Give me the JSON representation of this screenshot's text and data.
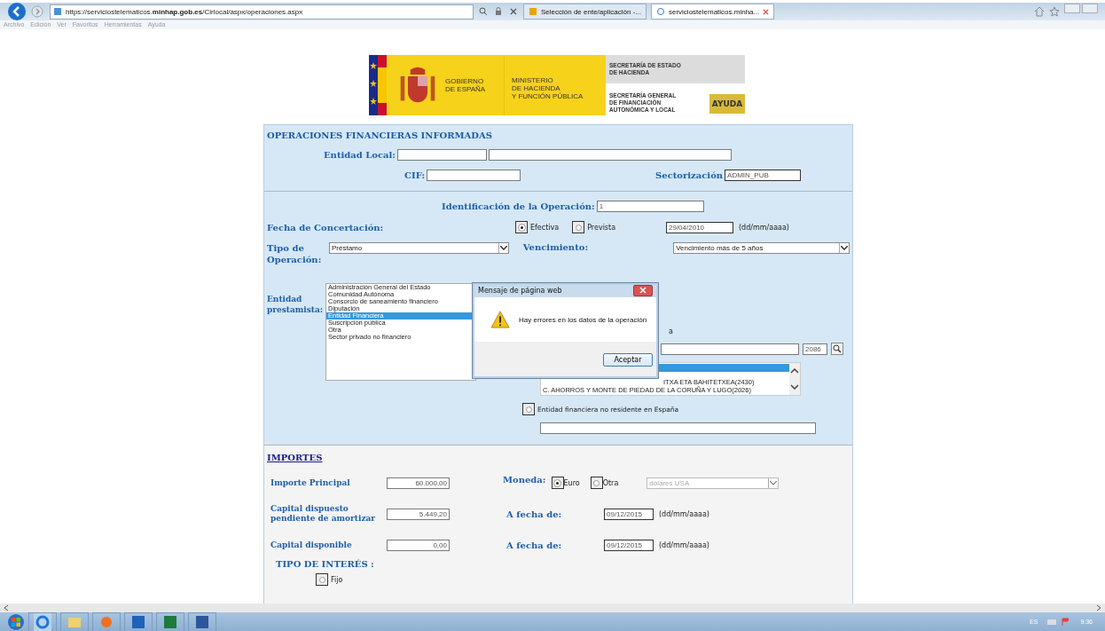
{
  "browser": {
    "address": "https://serviciostelematicos.**minhap.gob.es**/Cirlocal/aspx/operaciones.aspx",
    "tabs": [
      {
        "label": "Selección de ente/aplicación -...",
        "selected": false
      },
      {
        "label": "serviciostelematicos.minha...",
        "selected": true
      }
    ],
    "menu": [
      "Archivo",
      "Edición",
      "Ver",
      "Favoritos",
      "Herramientas",
      "Ayuda"
    ]
  },
  "banner": {
    "gobierno": [
      "GOBIERNO",
      "DE ESPAÑA"
    ],
    "ministerio": [
      "MINISTERIO",
      "DE HACIENDA",
      "Y FUNCIÓN PÚBLICA"
    ],
    "secretaria_estado": [
      "SECRETARÍA DE ESTADO",
      "DE HACIENDA"
    ],
    "secretaria_general": [
      "SECRETARÍA GENERAL",
      "DE FINANCIACIÓN",
      "AUTONÓMICA Y LOCAL"
    ],
    "help_button": "AYUDA"
  },
  "form": {
    "title": "OPERACIONES FINANCIERAS INFORMADAS",
    "entidad_local_label": "Entidad Local:",
    "cif_label": "CIF:",
    "sectorizacion_label": "Sectorización",
    "sectorizacion_value": "ADMIN_PUB",
    "identificacion_label": "Identificación de la Operación:",
    "identificacion_value": "1",
    "fecha_label": "Fecha de Concertación:",
    "fecha_options": [
      {
        "label": "Efectiva",
        "selected": true
      },
      {
        "label": "Prevista",
        "selected": false
      }
    ],
    "fecha_value": "29/04/2010",
    "fecha_hint": "(dd/mm/aaaa)",
    "tipo_label": "Tipo de Operación:",
    "tipo_value": "Préstamo",
    "vencimiento_label": "Vencimiento:",
    "vencimiento_value": "Vencimiento más de 5 años",
    "prestamista_label": "Entidad prestamista:",
    "prestamista_options": [
      {
        "label": "Administración General del Estado",
        "selected": false
      },
      {
        "label": "Comunidad Autónoma",
        "selected": false
      },
      {
        "label": "Consorcio de saneamiento financiero",
        "selected": false
      },
      {
        "label": "Diputación",
        "selected": false
      },
      {
        "label": "Entidad Financiera",
        "selected": true
      },
      {
        "label": "Suscripción pública",
        "selected": false
      },
      {
        "label": "Otra",
        "selected": false
      },
      {
        "label": "Sector privado no financiero",
        "selected": false
      }
    ],
    "entidad_label_fragment": "a",
    "entidad_code": "2086",
    "entidades": [
      {
        "selected": true
      },
      {
        "text": "ITXA ETA BAHITETXEA(2430)",
        "selected": false
      },
      {
        "text": "C. AHORROS Y MONTE DE PIEDAD DE LA CORUÑA Y LUGO(2026)",
        "selected": false
      }
    ],
    "no_residente": {
      "label": "Entidad financiera no residente en España",
      "selected": false
    }
  },
  "importes": {
    "title": "IMPORTES",
    "principal_label": "Importe Principal",
    "principal_value": "60.000,00",
    "moneda_label": "Moneda:",
    "moneda_options": [
      {
        "label": "Euro",
        "selected": true
      },
      {
        "label": "Otra",
        "selected": false
      }
    ],
    "moneda_value": "dólares USA",
    "dispuesto_label": "Capital dispuesto pendiente de amortizar",
    "dispuesto_value": "5.449,20",
    "dispuesto_fecha_label": "A fecha de:",
    "dispuesto_fecha": "09/12/2015",
    "dispuesto_hint": "(dd/mm/aaaa)",
    "disponible_label": "Capital disponible",
    "disponible_value": "0,00",
    "disponible_fecha_label": "A fecha de:",
    "disponible_fecha": "09/12/2015",
    "disponible_hint": "(dd/mm/aaaa)",
    "interes_title": "TIPO DE INTERÉS :",
    "interes_options": [
      {
        "label": "Fijo",
        "selected": false
      }
    ]
  },
  "dialog": {
    "title": "Mensaje de página web",
    "message": "Hay errores en los datos de la operación",
    "button": "Aceptar"
  },
  "taskbar": {
    "language": "ES",
    "time": "9:36"
  }
}
